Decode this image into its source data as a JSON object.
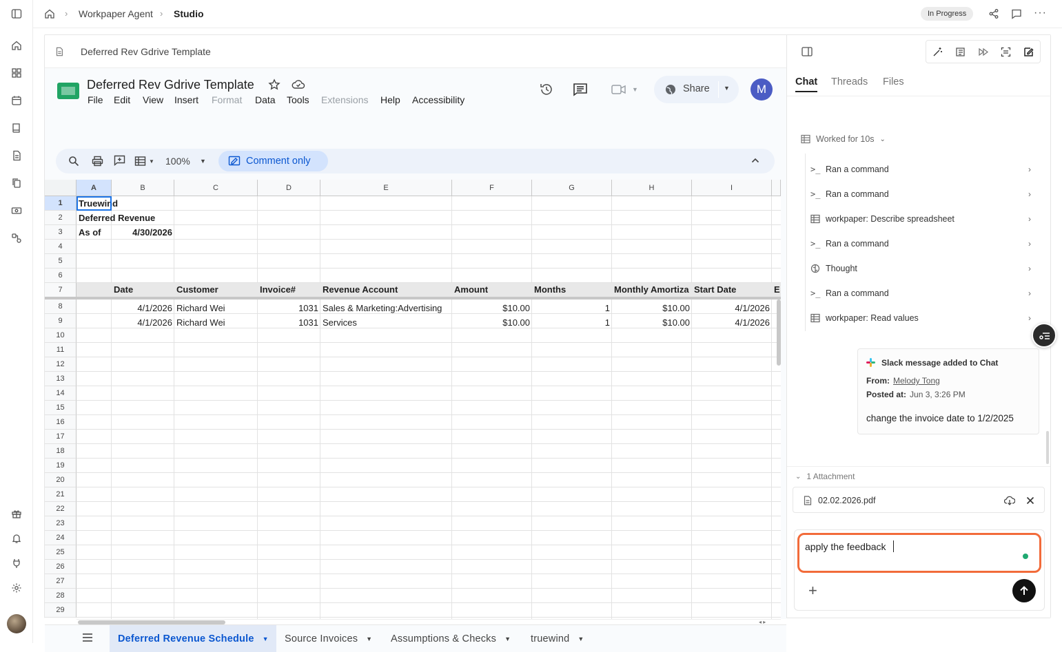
{
  "breadcrumb": {
    "root": "Workpaper Agent",
    "current": "Studio"
  },
  "status_badge": "In Progress",
  "doc_header_title": "Deferred Rev Gdrive Template",
  "sheet": {
    "title": "Deferred Rev Gdrive Template",
    "menus": [
      "File",
      "Edit",
      "View",
      "Insert",
      "Format",
      "Data",
      "Tools",
      "Extensions",
      "Help",
      "Accessibility"
    ],
    "share_label": "Share",
    "avatar_initial": "M",
    "zoom": "100%",
    "mode_label": "Comment only",
    "columns": [
      "A",
      "B",
      "C",
      "D",
      "E",
      "F",
      "G",
      "H",
      "I"
    ],
    "rows": [
      "1",
      "2",
      "3",
      "4",
      "5",
      "6",
      "7",
      "8",
      "9",
      "10",
      "11",
      "12",
      "13",
      "14",
      "15",
      "16",
      "17",
      "18",
      "19",
      "20",
      "21",
      "22",
      "23",
      "24",
      "25",
      "26",
      "27",
      "28",
      "29"
    ],
    "cells": {
      "a1": "Truewind",
      "a2": "Deferred Revenue",
      "a3": "As of",
      "b3": "4/30/2026",
      "headers": [
        "Date",
        "Customer",
        "Invoice#",
        "Revenue Account",
        "Amount",
        "Months",
        "Monthly Amortiza",
        "Start Date",
        "E"
      ],
      "data_rows": [
        [
          "4/1/2026",
          "Richard Wei",
          "1031",
          "Sales & Marketing:Advertising",
          "$10.00",
          "1",
          "$10.00",
          "4/1/2026"
        ],
        [
          "4/1/2026",
          "Richard Wei",
          "1031",
          "Services",
          "$10.00",
          "1",
          "$10.00",
          "4/1/2026"
        ]
      ]
    },
    "tabs": [
      "Deferred Revenue Schedule",
      "Source Invoices",
      "Assumptions & Checks",
      "truewind"
    ]
  },
  "panel": {
    "tabs": [
      "Chat",
      "Threads",
      "Files"
    ],
    "worked_label": "Worked for 10s",
    "steps": [
      {
        "icon": "terminal-icon",
        "label": "Ran a command"
      },
      {
        "icon": "terminal-icon",
        "label": "Ran a command"
      },
      {
        "icon": "table-icon",
        "label": "workpaper: Describe spreadsheet"
      },
      {
        "icon": "terminal-icon",
        "label": "Ran a command"
      },
      {
        "icon": "brain-icon",
        "label": "Thought"
      },
      {
        "icon": "terminal-icon",
        "label": "Ran a command"
      },
      {
        "icon": "table-icon",
        "label": "workpaper: Read values"
      }
    ],
    "slack": {
      "title": "Slack message added to Chat",
      "from_label": "From:",
      "from_name": "Melody Tong",
      "posted_label": "Posted at:",
      "posted_value": "Jun 3, 3:26 PM",
      "message": "change the invoice date to 1/2/2025"
    },
    "attachments_label": "1 Attachment",
    "attachment_name": "02.02.2026.pdf",
    "input_value": "apply the feedback",
    "colors": {
      "accent_orange": "#f26b3a",
      "green_dot": "#1fa971"
    }
  }
}
